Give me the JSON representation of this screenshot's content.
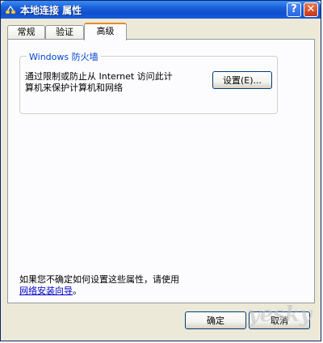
{
  "window": {
    "title": "本地连接 属性",
    "help_label": "?",
    "close_label": "✕"
  },
  "tabs": [
    {
      "label": "常规"
    },
    {
      "label": "验证"
    },
    {
      "label": "高级"
    }
  ],
  "firewall": {
    "group_title": "Windows 防火墙",
    "description_line1": "通过限制或防止从 Internet 访问此计",
    "description_line2": "算机来保护计算机和网络",
    "settings_button": "设置(E)..."
  },
  "footer": {
    "info_text": "如果您不确定如何设置这些属性，请使用",
    "info_link": "网络安装向导",
    "info_suffix": "。",
    "ok_button": "确定",
    "cancel_button": "取消"
  },
  "watermark": "yesky"
}
